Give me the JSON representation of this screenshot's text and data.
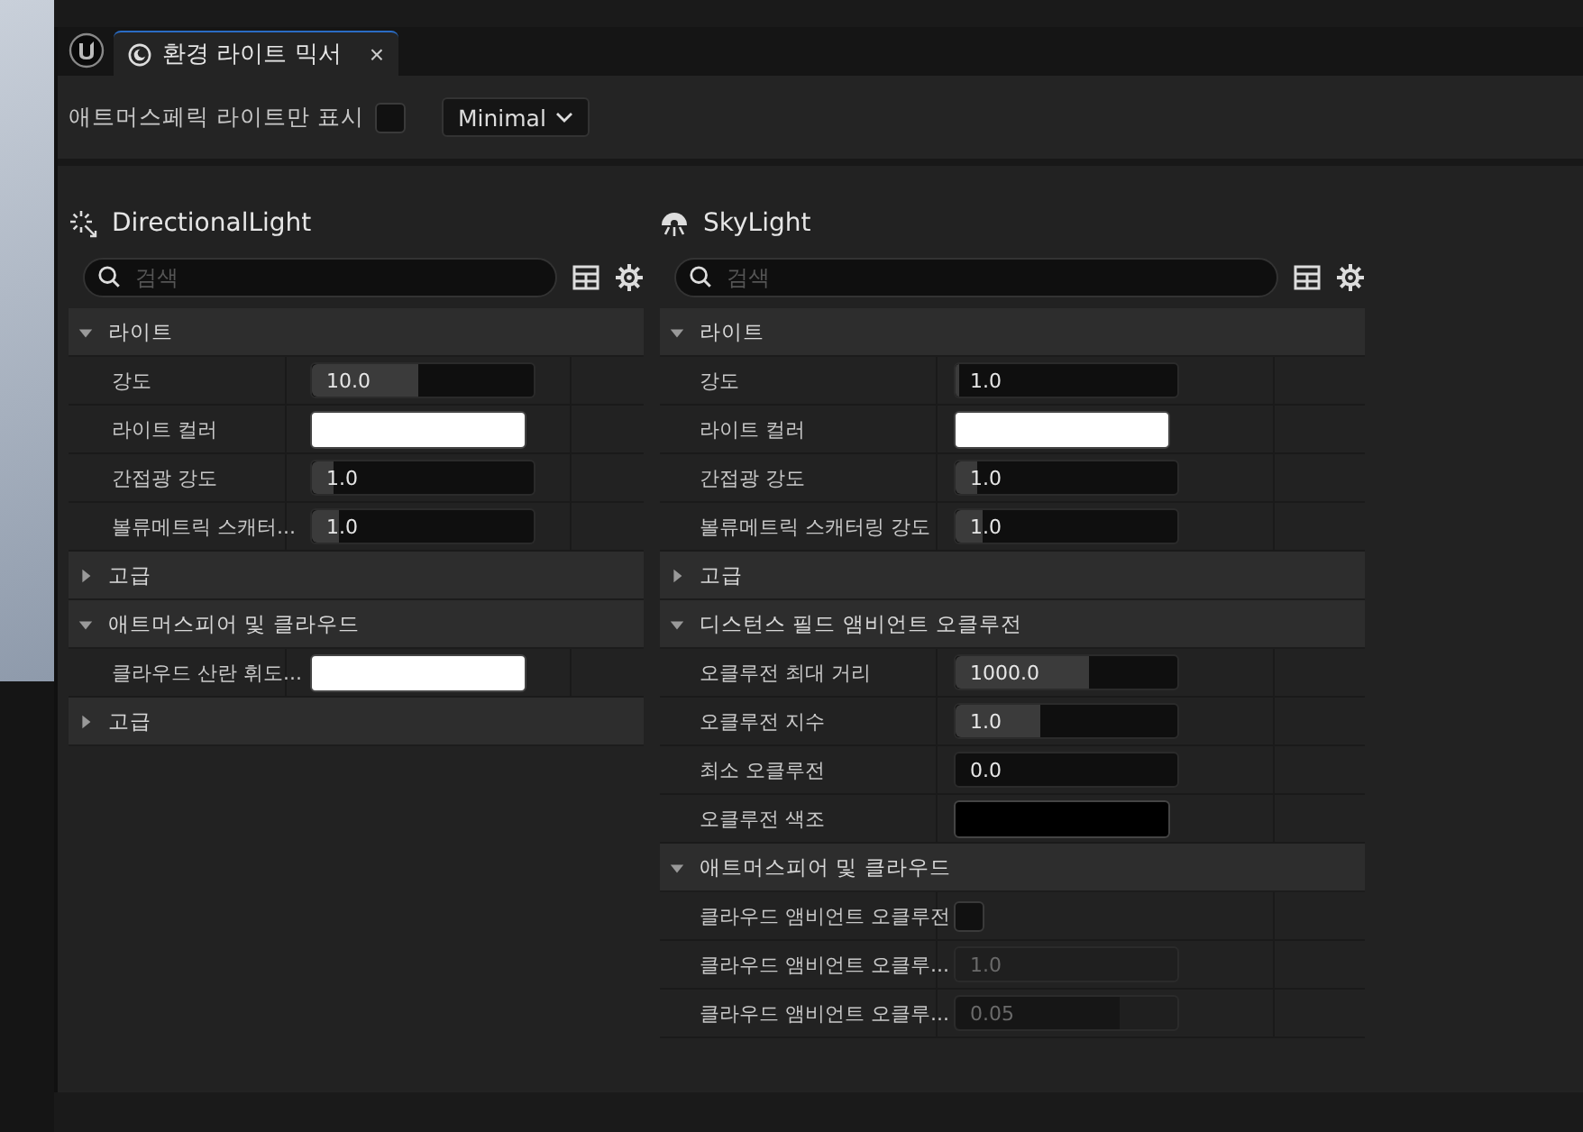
{
  "tab": {
    "title": "환경 라이트 믹서",
    "close": "×",
    "selected": true
  },
  "toolbar": {
    "checkbox_label": "애트머스페릭 라이트만 표시",
    "checked": false,
    "dropdown": "Minimal"
  },
  "panels": [
    {
      "title": "DirectionalLight",
      "kind": "directional",
      "search_placeholder": "검색",
      "sections": [
        {
          "label": "라이트",
          "expanded": true,
          "rows": [
            {
              "kind": "number",
              "label": "강도",
              "value": "10.0",
              "level": 0.48,
              "disabled": false
            },
            {
              "kind": "color",
              "label": "라이트 컬러",
              "color": "#ffffff"
            },
            {
              "kind": "number",
              "label": "간접광 강도",
              "value": "1.0",
              "level": 0.1,
              "disabled": false
            },
            {
              "kind": "number",
              "label": "볼류메트릭 스캐터...",
              "value": "1.0",
              "level": 0.12,
              "disabled": false
            }
          ]
        },
        {
          "label": "고급",
          "expanded": false
        },
        {
          "label": "애트머스피어 및 클라우드",
          "expanded": true,
          "rows": [
            {
              "kind": "color",
              "label": "클라우드 산란 휘도...",
              "color": "#ffffff"
            }
          ]
        },
        {
          "label": "고급",
          "expanded": false
        }
      ]
    },
    {
      "title": "SkyLight",
      "kind": "sky",
      "search_placeholder": "검색",
      "sections": [
        {
          "label": "라이트",
          "expanded": true,
          "rows": [
            {
              "kind": "number",
              "label": "강도",
              "value": "1.0",
              "level": 0.02,
              "disabled": false
            },
            {
              "kind": "color",
              "label": "라이트 컬러",
              "color": "#ffffff"
            },
            {
              "kind": "number",
              "label": "간접광 강도",
              "value": "1.0",
              "level": 0.1,
              "disabled": false
            },
            {
              "kind": "number",
              "label": "볼류메트릭 스캐터링 강도",
              "value": "1.0",
              "level": 0.12,
              "disabled": false
            }
          ]
        },
        {
          "label": "고급",
          "expanded": false
        },
        {
          "label": "디스턴스 필드 앰비언트 오클루전",
          "expanded": true,
          "rows": [
            {
              "kind": "number",
              "label": "오클루전 최대 거리",
              "value": "1000.0",
              "level": 0.6,
              "disabled": false
            },
            {
              "kind": "number",
              "label": "오클루전 지수",
              "value": "1.0",
              "level": 0.38,
              "disabled": false
            },
            {
              "kind": "number",
              "label": "최소 오클루전",
              "value": "0.0",
              "disabled": false
            },
            {
              "kind": "color",
              "label": "오클루전 색조",
              "color": "#000000"
            }
          ]
        },
        {
          "label": "애트머스피어 및 클라우드",
          "expanded": true,
          "rows": [
            {
              "kind": "checkbox",
              "label": "클라우드 앰비언트 오클루전",
              "checked": false
            },
            {
              "kind": "number",
              "label": "클라우드 앰비언트 오클루...",
              "value": "1.0",
              "disabled": true
            },
            {
              "kind": "number",
              "label": "클라우드 앰비언트 오클루...",
              "value": "0.05",
              "level": 0.74,
              "disabled": true
            }
          ]
        }
      ]
    }
  ]
}
